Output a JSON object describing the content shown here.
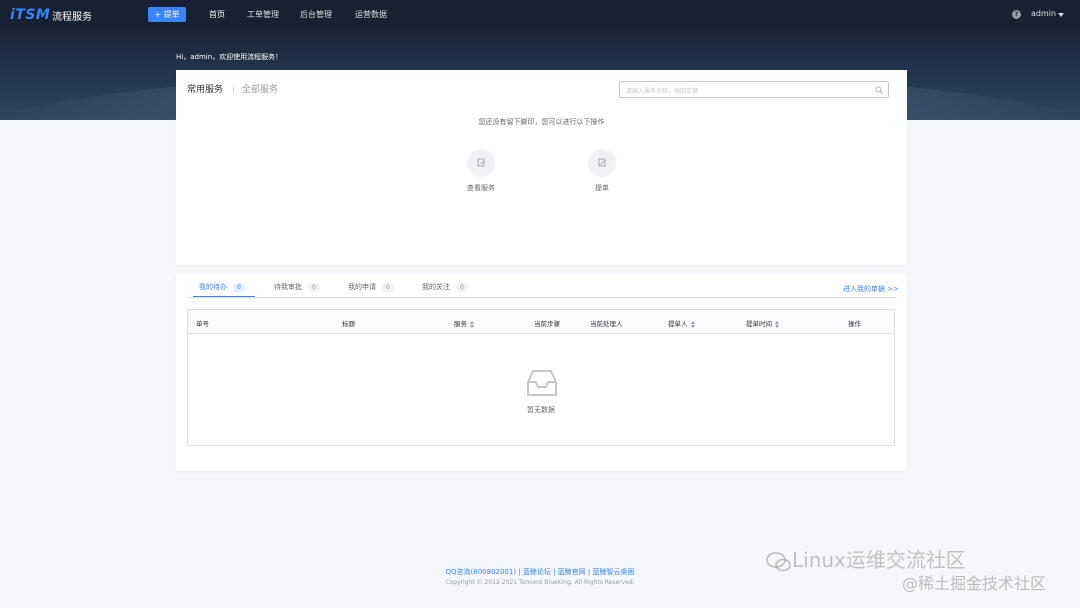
{
  "header": {
    "logo": "iTSM",
    "app_name": "流程服务",
    "create_label": "+ 提单",
    "nav": [
      "首页",
      "工单管理",
      "后台管理",
      "运营数据"
    ],
    "help": "?",
    "user": "admin"
  },
  "welcome": "Hi，admin，欢迎使用流程服务！",
  "services": {
    "tabs": [
      "常用服务",
      "全部服务"
    ],
    "search_placeholder": "请输入服务名称，按回车键",
    "empty_tip": "您还没有留下脚印，您可以进行以下操作",
    "actions": [
      {
        "label": "查看服务",
        "icon": "view-icon"
      },
      {
        "label": "提单",
        "icon": "edit-icon"
      }
    ]
  },
  "tickets": {
    "tabs": [
      {
        "label": "我的待办",
        "count": "0"
      },
      {
        "label": "待我审批",
        "count": "0"
      },
      {
        "label": "我的申请",
        "count": "0"
      },
      {
        "label": "我的关注",
        "count": "0"
      }
    ],
    "more_link": "进入我的单据 >>",
    "columns": [
      "单号",
      "标题",
      "服务",
      "当前步骤",
      "当前处理人",
      "提单人",
      "提单时间",
      "操作"
    ],
    "empty_text": "暂无数据"
  },
  "footer": {
    "links": "QQ咨询(800802001) | 蓝鲸论坛 | 蓝鲸官网 | 蓝鲸智云桌面",
    "copyright": "Copyright © 2012-2021 Tencent BlueKing. All Rights Reserved."
  },
  "watermark": {
    "line1": "Linux运维交流社区",
    "line2": "@稀土掘金技术社区"
  },
  "colors": {
    "accent": "#3a84ff",
    "topbar": "#182132",
    "page_bg": "#f5f7fa"
  }
}
